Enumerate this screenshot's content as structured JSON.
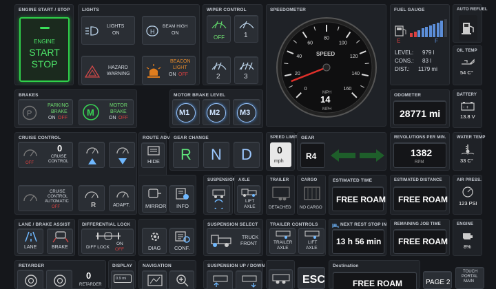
{
  "engine": {
    "title": "ENGINE START / STOP",
    "label1": "ENGINE",
    "label2": "START",
    "label3": "STOP"
  },
  "lights": {
    "title": "LIGHTS",
    "lights_label": "LIGHTS",
    "lights_state": "ON",
    "beam_label": "BEAM HIGH",
    "beam_state": "ON",
    "hazard_label1": "HAZARD",
    "hazard_label2": "WARNING",
    "beacon_label1": "BEACON",
    "beacon_label2": "LIGHT",
    "beacon_on": "ON",
    "beacon_off": "OFF"
  },
  "wiper": {
    "title": "WIPER CONTROL",
    "off": "OFF",
    "w1": "1",
    "w2": "2",
    "w3": "3"
  },
  "speedometer": {
    "title": "SPEEDOMETER",
    "speed_label": "SPEED",
    "unit_top": "MPH",
    "value": "14",
    "unit_bottom": "MPH",
    "ticks": [
      "0",
      "20",
      "40",
      "60",
      "80",
      "100",
      "120",
      "140",
      "160"
    ],
    "needle_value": 14
  },
  "fuel": {
    "title": "FUEL GAUGE",
    "e": "E",
    "f": "F",
    "level_label": "LEVEL:",
    "level_value": "979 l",
    "cons_label": "CONS.:",
    "cons_value": "83 l",
    "dist_label": "DIST.:",
    "dist_value": "1179 mi",
    "bars_filled": 9,
    "bars_total": 10
  },
  "autorefuel": {
    "title": "AUTO REFUEL"
  },
  "oiltemp": {
    "title": "OIL TEMP",
    "value": "54 C°"
  },
  "brakes": {
    "title": "BRAKES",
    "parking1": "PARKING",
    "parking2": "BRAKE",
    "parking_on": "ON",
    "parking_off": "OFF",
    "motor1": "MOTOR",
    "motor2": "BRAKE",
    "motor_on": "ON",
    "motor_off": "OFF"
  },
  "motorbrake": {
    "title": "MOTOR BRAKE LEVEL",
    "m1": "M1",
    "m2": "M2",
    "m3": "M3"
  },
  "odometer": {
    "title": "ODOMETER",
    "value": "28771 mi"
  },
  "battery": {
    "title": "BATTERY",
    "value": "13.8 V"
  },
  "cruise": {
    "title": "CRUISE CONTROL",
    "value": "0",
    "label1": "CRUISE",
    "label2": "CONTROL",
    "off": "OFF",
    "auto1": "CRUISE",
    "auto2": "CONTROL",
    "auto3": "AUTOMATIC",
    "auto_off": "OFF",
    "adapt": "ADAPT."
  },
  "routeadv": {
    "title": "ROUTE ADV",
    "hide": "HIDE",
    "mirror": "MIRROR",
    "info": "INFO"
  },
  "gear_change": {
    "title": "GEAR CHANGE",
    "r": "R",
    "n": "N",
    "d": "D"
  },
  "speedlimit": {
    "title": "SPEED LIMIT",
    "value": "0",
    "unit": "mph"
  },
  "gear": {
    "title": "GEAR",
    "value": "R4"
  },
  "rpm": {
    "title": "REVOLUTIONS PER MIN.",
    "value": "1382",
    "unit": "RPM"
  },
  "watertemp": {
    "title": "WATER TEMP",
    "value": "33 C°"
  },
  "suspension": {
    "title": "SUSPENSION"
  },
  "axle": {
    "title": "AXLE",
    "lift1": "LIFT",
    "lift2": "AXLE"
  },
  "trailer": {
    "title": "TRAILER",
    "detached": "DETACHED"
  },
  "cargo": {
    "title": "CARGO",
    "value": "NO CARGO"
  },
  "esttime": {
    "title": "ESTIMATED TIME",
    "value": "FREE ROAM"
  },
  "estdist": {
    "title": "ESTIMATED DISTANCE",
    "value": "FREE ROAM"
  },
  "airpress": {
    "title": "AIR PRESS.",
    "value": "123 PSI"
  },
  "lane": {
    "title": "LANE / BRAKE ASSIST",
    "lane": "LANE",
    "brake": "BRAKE"
  },
  "difflock": {
    "title": "DIFFERENTIAL LOCK",
    "label": "DIFF LOCK",
    "on": "ON",
    "off": "OFF"
  },
  "diag": {
    "diag": "DIAG",
    "conf": "CONF."
  },
  "suspselect": {
    "title": "SUSPENSION SELECT",
    "truck1": "TRUCK",
    "truck2": "FRONT"
  },
  "trailerctl": {
    "title": "TRAILER CONTROLS",
    "t1a": "TRAILER",
    "t1b": "AXLE",
    "t2a": "LIFT",
    "t2b": "AXLE"
  },
  "nextrest": {
    "title": "NEXT REST STOP IN",
    "value": "13 h  56 min"
  },
  "remaining": {
    "title": "REMAINING JOB TIME",
    "value": "FREE ROAM"
  },
  "engine_status": {
    "title": "ENGINE",
    "value": "8%"
  },
  "retarder": {
    "title": "RETARDER",
    "value": "0",
    "label": "RETARDER"
  },
  "display": {
    "title": "DISPLAY",
    "value": "0.9 mi"
  },
  "navigation": {
    "title": "NAVIGATION"
  },
  "suspupdown": {
    "title": "SUSPENSION UP / DOWN"
  },
  "esc": {
    "label": "ESC"
  },
  "destination": {
    "title": "Destination",
    "value": "FREE ROAM"
  },
  "page": {
    "label": "PAGE 2"
  },
  "touchportal": {
    "l1": "TOUCH",
    "l2": "PORTAL",
    "l3": "MAIN"
  }
}
